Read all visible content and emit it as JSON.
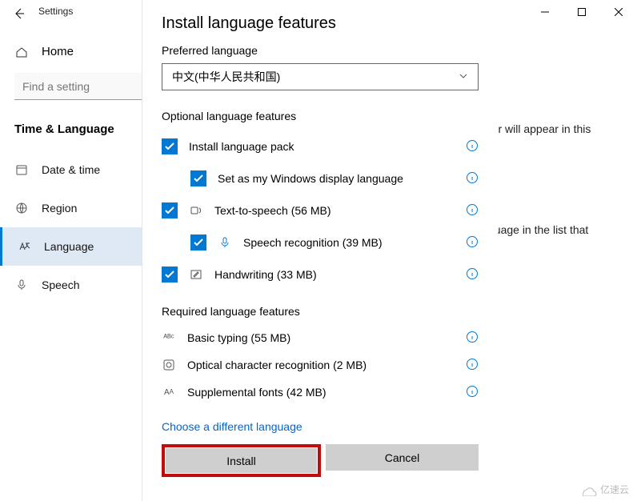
{
  "window": {
    "title": "Settings",
    "controls": {
      "min": "minimize",
      "max": "maximize",
      "close": "close"
    }
  },
  "nav": {
    "home": "Home",
    "find_placeholder": "Find a setting",
    "section": "Time & Language",
    "items": [
      {
        "label": "Date & time",
        "icon": "clock-icon"
      },
      {
        "label": "Region",
        "icon": "globe-icon"
      },
      {
        "label": "Language",
        "icon": "language-icon",
        "selected": true
      },
      {
        "label": "Speech",
        "icon": "mic-icon"
      }
    ]
  },
  "bg": {
    "line1": "rer will appear in this",
    "line2": "guage in the list that"
  },
  "dialog": {
    "title": "Install language features",
    "preferred_label": "Preferred language",
    "selected_language": "中文(中华人民共和国)",
    "optional_header": "Optional language features",
    "optional": [
      {
        "label": "Install language pack",
        "checked": true
      },
      {
        "label": "Set as my Windows display language",
        "checked": true,
        "indent": true
      },
      {
        "label": "Text-to-speech (56 MB)",
        "checked": true,
        "icon": "tts-icon"
      },
      {
        "label": "Speech recognition (39 MB)",
        "checked": true,
        "indent": true,
        "icon": "mic-icon"
      },
      {
        "label": "Handwriting (33 MB)",
        "checked": true,
        "icon": "pen-icon"
      }
    ],
    "required_header": "Required language features",
    "required": [
      {
        "label": "Basic typing (55 MB)",
        "icon": "abc-icon"
      },
      {
        "label": "Optical character recognition (2 MB)",
        "icon": "ocr-icon"
      },
      {
        "label": "Supplemental fonts (42 MB)",
        "icon": "font-icon"
      }
    ],
    "choose_link": "Choose a different language",
    "install_btn": "Install",
    "cancel_btn": "Cancel"
  },
  "watermark": "亿速云"
}
